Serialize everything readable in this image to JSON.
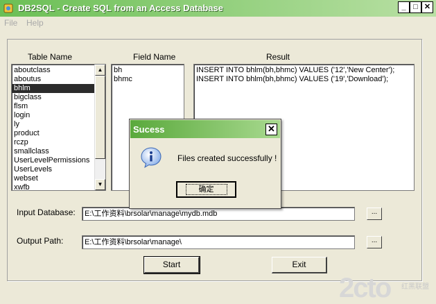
{
  "window": {
    "title": "DB2SQL - Create SQL from an Access Database"
  },
  "menu": [
    {
      "label": "File"
    },
    {
      "label": "Help"
    }
  ],
  "labels": {
    "table_name": "Table Name",
    "field_name": "Field Name",
    "result": "Result",
    "input_database": "Input Database:",
    "output_path": "Output Path:"
  },
  "tables": [
    "aboutclass",
    "aboutus",
    "bhlm",
    "bigclass",
    "flsm",
    "login",
    "ly",
    "product",
    "rczp",
    "smallclass",
    "UserLevelPermissions",
    "UserLevels",
    "webset",
    "xwfb"
  ],
  "selected_table": "bhlm",
  "fields": [
    "bh",
    "bhmc"
  ],
  "result_lines": [
    "INSERT INTO bhlm(bh,bhmc) VALUES ('12','New Center');",
    "INSERT INTO bhlm(bh,bhmc) VALUES ('19','Download');"
  ],
  "inputs": {
    "input_database": "E:\\工作资料\\brsolar\\manage\\mydb.mdb",
    "output_path": "E:\\工作资料\\brsolar\\manage\\"
  },
  "buttons": {
    "browse": "...",
    "start": "Start",
    "exit": "Exit"
  },
  "dialog": {
    "title": "Sucess",
    "message": "Files created successfully !",
    "ok": "确定",
    "icon": "info-icon"
  },
  "watermark": {
    "main": "2cto",
    "side": "红黑联盟"
  },
  "colors": {
    "titlebar": "#6bbf55",
    "face": "#ece9d8",
    "selection": "#2b2b2b"
  }
}
